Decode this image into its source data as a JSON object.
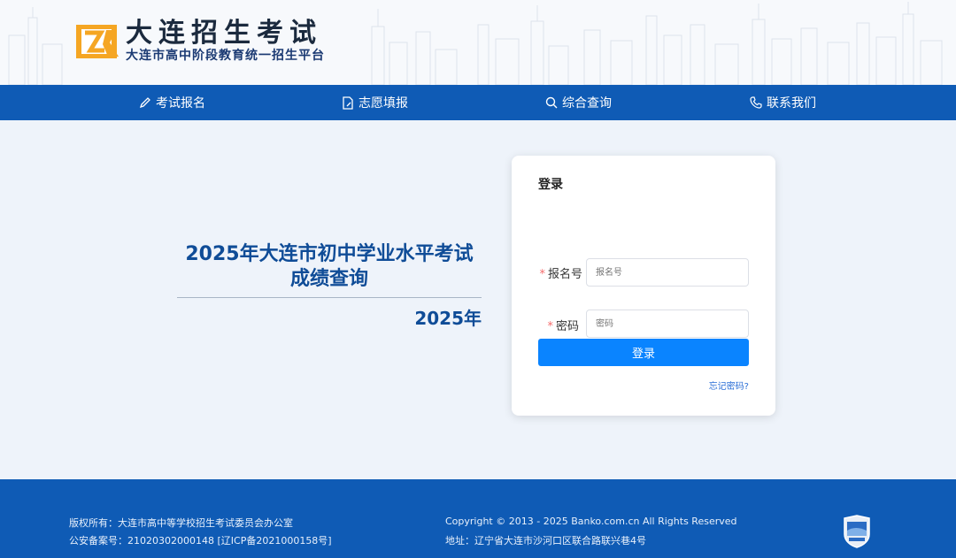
{
  "header": {
    "logo_title": "大连招生考试",
    "logo_subtitle": "大连市高中阶段教育统一招生平台"
  },
  "nav": {
    "items": [
      {
        "label": "考试报名",
        "icon": "pencil-icon"
      },
      {
        "label": "志愿填报",
        "icon": "document-edit-icon"
      },
      {
        "label": "综合查询",
        "icon": "search-icon"
      },
      {
        "label": "联系我们",
        "icon": "phone-icon"
      }
    ]
  },
  "main": {
    "title_line1": "2025年大连市初中学业水平考试",
    "title_line2": "成绩查询",
    "year": "2025年"
  },
  "login": {
    "title": "登录",
    "fields": [
      {
        "label": "报名号",
        "placeholder": "报名号",
        "required": "*"
      },
      {
        "label": "密码",
        "placeholder": "密码",
        "required": "*"
      }
    ],
    "submit_label": "登录",
    "forgot_label": "忘记密码?"
  },
  "footer": {
    "copyright_owner": "版权所有：大连市高中等学校招生考试委员会办公室",
    "police_record": "公安备案号：21020302000148 [辽ICP备2021000158号]",
    "copyright": "Copyright © 2013 - 2025 Banko.com.cn All Rights Reserved",
    "address": "地址：辽宁省大连市沙河口区联合路联兴巷4号"
  },
  "colors": {
    "nav_bg": "#0f5bb5",
    "accent": "#0a84ff",
    "title_blue": "#0f4c97",
    "page_bg": "#eef3fa"
  }
}
